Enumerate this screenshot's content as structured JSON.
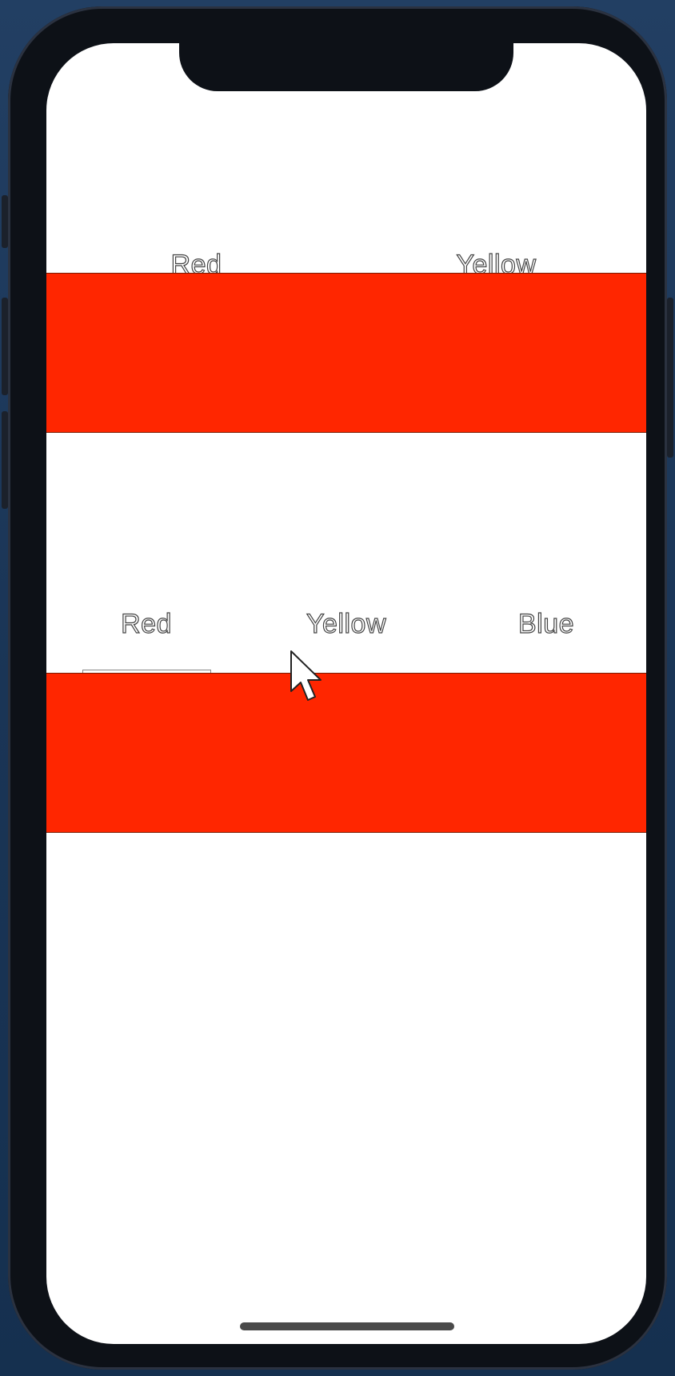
{
  "colors": {
    "panel": "#ff2600",
    "screen_bg": "#ffffff",
    "frame": "#0d1117"
  },
  "top_tabs": {
    "items": [
      {
        "label": "Red",
        "selected": true
      },
      {
        "label": "Yellow",
        "selected": false
      }
    ],
    "panel_color": "#ff2600"
  },
  "bottom_tabs": {
    "items": [
      {
        "label": "Red",
        "selected": true
      },
      {
        "label": "Yellow",
        "selected": false
      },
      {
        "label": "Blue",
        "selected": false
      }
    ],
    "panel_color": "#ff2600"
  },
  "cursor": {
    "icon": "arrow-pointer-icon"
  }
}
